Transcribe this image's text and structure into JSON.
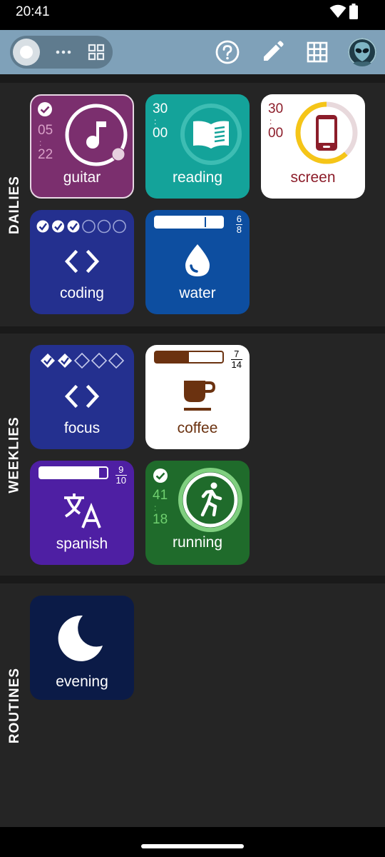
{
  "status_bar": {
    "time": "20:41"
  },
  "app_bar": {
    "icons": [
      "toggle-knob",
      "more-dots-icon",
      "grid-view-icon",
      "help-icon",
      "edit-icon",
      "table-grid-icon",
      "alien-avatar"
    ]
  },
  "colors": {
    "appbar": "#7fa1b9",
    "section_bg": "#252525",
    "guitar": "#7b2f6e",
    "reading": "#14a39a",
    "screen": "#ffffff",
    "coding": "#24308f",
    "water": "#0d4ea0",
    "focus": "#24308f",
    "coffee": "#ffffff",
    "spanish": "#4e1fa3",
    "running": "#1f6b2b",
    "evening": "#0b1b47"
  },
  "sections": {
    "dailies": {
      "label": "DAILIES",
      "tiles": {
        "guitar": {
          "label": "guitar",
          "timer_top": "05",
          "timer_bottom": "22",
          "icon": "music-note-icon",
          "completed": true
        },
        "reading": {
          "label": "reading",
          "timer_top": "30",
          "timer_bottom": "00",
          "icon": "book-icon"
        },
        "screen": {
          "label": "screen",
          "timer_top": "30",
          "timer_bottom": "00",
          "icon": "phone-icon",
          "ring_progress": 0.62
        },
        "coding": {
          "label": "coding",
          "icon": "code-icon",
          "checks_done": 3,
          "checks_total": 6
        },
        "water": {
          "label": "water",
          "icon": "water-drop-icon",
          "numerator": "6",
          "denominator": "8",
          "progress": 0.75
        }
      }
    },
    "weeklies": {
      "label": "WEEKLIES",
      "tiles": {
        "focus": {
          "label": "focus",
          "icon": "code-icon",
          "checks_done": 2,
          "checks_total": 5
        },
        "coffee": {
          "label": "coffee",
          "icon": "coffee-cup-icon",
          "numerator": "7",
          "denominator": "14",
          "progress": 0.5
        },
        "spanish": {
          "label": "spanish",
          "icon": "translate-icon",
          "numerator": "9",
          "denominator": "10",
          "progress": 0.9
        },
        "running": {
          "label": "running",
          "icon": "running-person-icon",
          "timer_top": "41",
          "timer_bottom": "18",
          "completed": true
        }
      }
    },
    "routines": {
      "label": "ROUTINES",
      "tiles": {
        "evening": {
          "label": "evening",
          "icon": "moon-icon"
        }
      }
    }
  }
}
